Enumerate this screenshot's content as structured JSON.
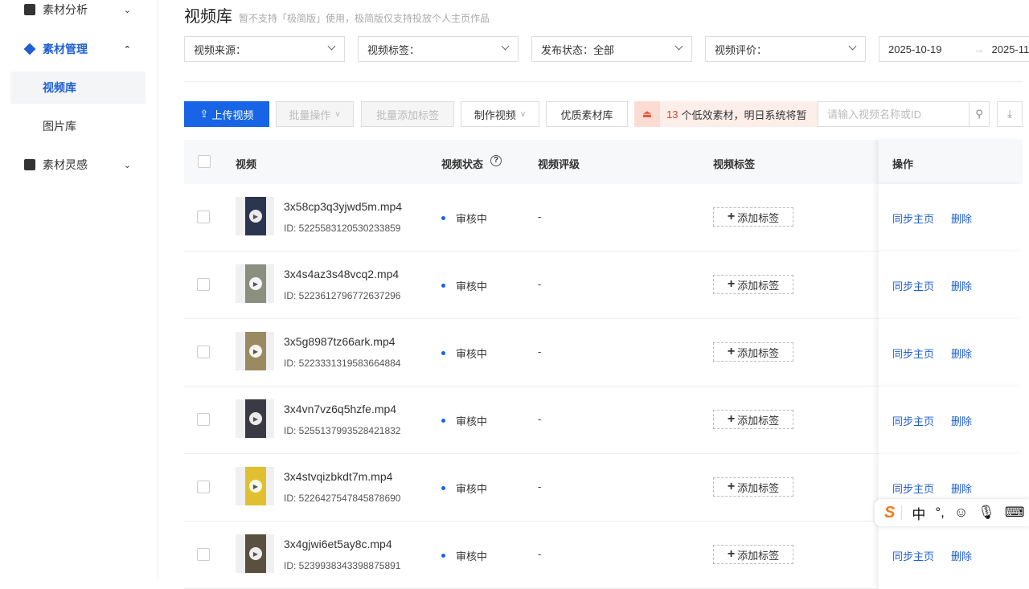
{
  "sidebar": {
    "items": [
      {
        "label": "素材分析",
        "chev": "⌄"
      },
      {
        "label": "素材管理",
        "chev": "⌃"
      },
      {
        "label": "视频库"
      },
      {
        "label": "图片库"
      },
      {
        "label": "素材灵感",
        "chev": "⌄"
      }
    ]
  },
  "header": {
    "title": "视频库",
    "hint": "暂不支持「极简版」使用，极简版仅支持投放个人主页作品"
  },
  "filters": {
    "source": "视频来源：",
    "tag": "视频标签：",
    "publish": "发布状态：全部",
    "rating": "视频评价：",
    "date_start": "2025-10-19",
    "date_arrow": "→",
    "date_end": "2025-11"
  },
  "toolbar": {
    "upload": "上传视频",
    "batch": "批量操作",
    "batch_tag": "批量添加标签",
    "make": "制作视频",
    "quality": "优质素材库",
    "alert_count": "13",
    "alert_text": "个低效素材，明日系统将暂",
    "search_placeholder": "请输入视频名称或ID"
  },
  "table": {
    "headers": {
      "video": "视频",
      "status": "视频状态",
      "rating": "视频评级",
      "tags": "视频标签",
      "ops": "操作"
    },
    "add_tag": "添加标签",
    "sync": "同步主页",
    "delete": "删除",
    "rows": [
      {
        "name": "3x58cp3q3yjwd5m.mp4",
        "id": "ID: 5225583120530233859",
        "status": "审核中",
        "rating": "-",
        "thumb": "#2a3550"
      },
      {
        "name": "3x4s4az3s48vcq2.mp4",
        "id": "ID: 5223612796772637296",
        "status": "审核中",
        "rating": "-",
        "thumb": "#8a8f80"
      },
      {
        "name": "3x5g8987tz66ark.mp4",
        "id": "ID: 5223331319583664884",
        "status": "审核中",
        "rating": "-",
        "thumb": "#9a8a60"
      },
      {
        "name": "3x4vn7vz6q5hzfe.mp4",
        "id": "ID: 5255137993528421832",
        "status": "审核中",
        "rating": "-",
        "thumb": "#3a3a44"
      },
      {
        "name": "3x4stvqizbkdt7m.mp4",
        "id": "ID: 5226427547845878690",
        "status": "审核中",
        "rating": "-",
        "thumb": "#e0c030"
      },
      {
        "name": "3x4gjwi6et5ay8c.mp4",
        "id": "ID: 5239938343398875891",
        "status": "审核中",
        "rating": "-",
        "thumb": "#5a5040"
      }
    ]
  },
  "ime": {
    "lang": "中",
    "punct": "°,"
  }
}
